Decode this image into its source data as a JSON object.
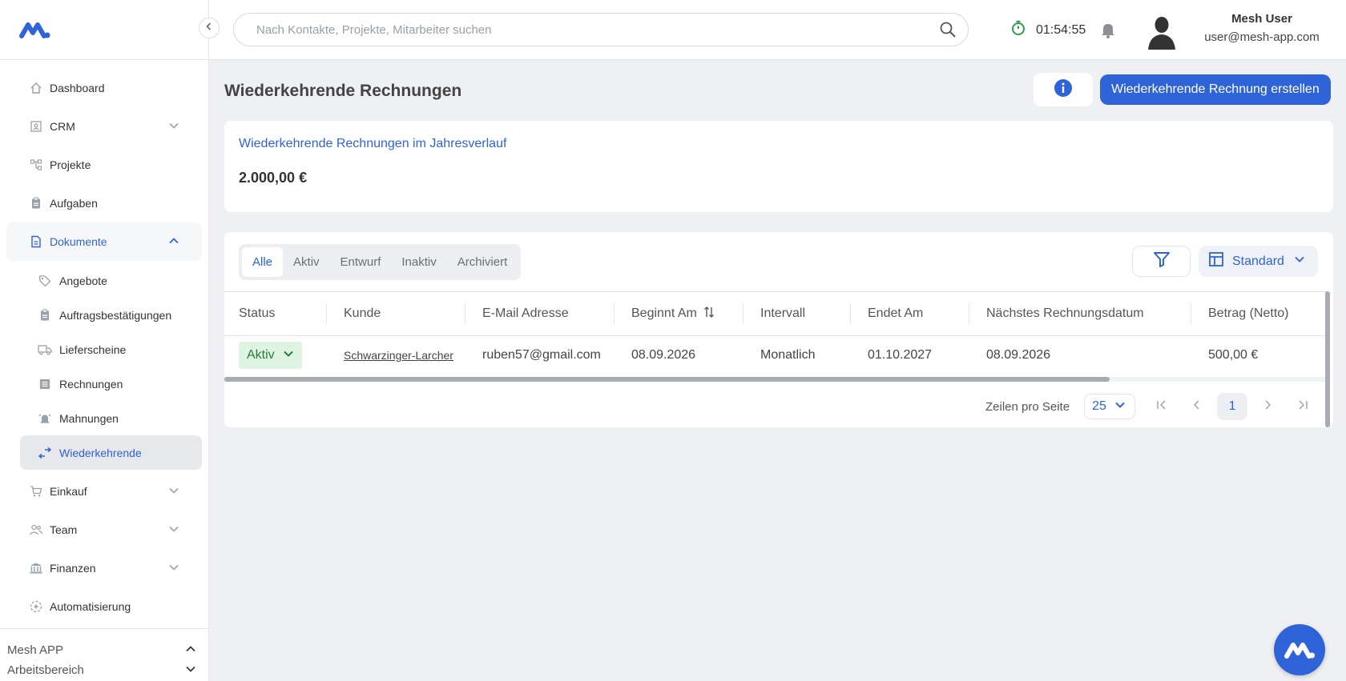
{
  "app": {
    "logo_icon": "mesh-logo-icon",
    "brand_color": "#2f63d8"
  },
  "topbar": {
    "search_placeholder": "Nach Kontakte, Projekte, Mitarbeiter suchen",
    "timer": "01:54:55",
    "user_name": "Mesh User",
    "user_email": "user@mesh-app.com"
  },
  "sidebar": {
    "items": [
      {
        "label": "Dashboard",
        "icon": "home-icon"
      },
      {
        "label": "CRM",
        "icon": "contact-card-icon",
        "expandable": true
      },
      {
        "label": "Projekte",
        "icon": "project-tree-icon"
      },
      {
        "label": "Aufgaben",
        "icon": "clipboard-icon"
      },
      {
        "label": "Dokumente",
        "icon": "document-icon",
        "expandable": true,
        "open": true
      }
    ],
    "documents_sub": [
      {
        "label": "Angebote",
        "icon": "tag-icon"
      },
      {
        "label": "Auftragsbestätigungen",
        "icon": "clipboard-check-icon"
      },
      {
        "label": "Lieferscheine",
        "icon": "truck-icon"
      },
      {
        "label": "Rechnungen",
        "icon": "invoice-icon"
      },
      {
        "label": "Mahnungen",
        "icon": "alarm-icon"
      },
      {
        "label": "Wiederkehrende",
        "icon": "recurring-icon",
        "active": true
      }
    ],
    "items_after": [
      {
        "label": "Einkauf",
        "icon": "cart-icon",
        "expandable": true
      },
      {
        "label": "Team",
        "icon": "team-icon",
        "expandable": true
      },
      {
        "label": "Finanzen",
        "icon": "bank-icon",
        "expandable": true
      },
      {
        "label": "Automatisierung",
        "icon": "automation-icon"
      }
    ],
    "workspace": {
      "app_name": "Mesh APP",
      "label": "Arbeitsbereich"
    }
  },
  "page": {
    "title": "Wiederkehrende Rechnungen",
    "create_label": "Wiederkehrende Rechnung erstellen"
  },
  "summary": {
    "link_label": "Wiederkehrende Rechnungen im Jahresverlauf",
    "amount": "2.000,00 €"
  },
  "tabs": [
    "Alle",
    "Aktiv",
    "Entwurf",
    "Inaktiv",
    "Archiviert"
  ],
  "active_tab": "Alle",
  "view": {
    "label": "Standard"
  },
  "table": {
    "columns": [
      "Status",
      "Kunde",
      "E-Mail Adresse",
      "Beginnt Am",
      "Intervall",
      "Endet Am",
      "Nächstes Rechnungsdatum",
      "Betrag (Netto)"
    ],
    "rows": [
      {
        "status": "Aktiv",
        "kunde": "Schwarzinger-Larcher",
        "email": "ruben57@gmail.com",
        "beginnt": "08.09.2026",
        "intervall": "Monatlich",
        "endet": "01.10.2027",
        "naechstes": "08.09.2026",
        "betrag": "500,00 €"
      }
    ]
  },
  "pagination": {
    "rows_label": "Zeilen pro Seite",
    "rows_per_page": "25",
    "current_page": "1"
  }
}
